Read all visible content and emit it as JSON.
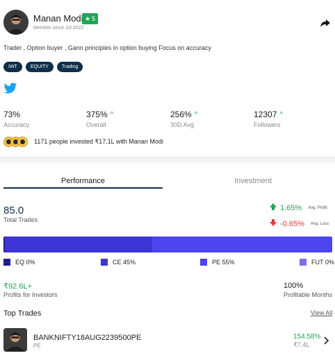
{
  "profile": {
    "name": "Manan Modi",
    "rating": "5",
    "member_since": "Member since Jul 2022",
    "bio": "Trader , Option buyer , Gann principles in option buying Focus on accuracy",
    "tags": [
      "IWT",
      "EQUITY",
      "Trading"
    ],
    "social": "twitter-icon"
  },
  "stats": [
    {
      "value": "73%",
      "label": "Accuracy",
      "trend": ""
    },
    {
      "value": "375%",
      "label": "Overall",
      "trend": "up"
    },
    {
      "value": "256%",
      "label": "30D Avg",
      "trend": "up"
    },
    {
      "value": "12307",
      "label": "Followers",
      "trend": "up"
    }
  ],
  "investors": {
    "text": "1171 people invested ₹17.1L with Manan Modi"
  },
  "tabs": {
    "performance": "Performance",
    "investment": "Investment",
    "active": "Performance"
  },
  "performance": {
    "total_trades_value": "85.0",
    "total_trades_label": "Total Trades",
    "avg_profit_value": "1.65%",
    "avg_profit_label": "Avg. Profit",
    "avg_loss_value": "-0.65%",
    "avg_loss_label": "Avg. Loss",
    "distribution": [
      {
        "label": "EQ 0%",
        "percent": 0,
        "color": "#1e1e8c"
      },
      {
        "label": "CE 45%",
        "percent": 45,
        "color": "#3d34d6"
      },
      {
        "label": "PE 55%",
        "percent": 55,
        "color": "#4c44ef"
      },
      {
        "label": "FUT 0%",
        "percent": 0,
        "color": "#7b6ef0"
      }
    ],
    "profits_value": "₹92.6L+",
    "profits_label": "Profits for Investors",
    "profitable_months_value": "100%",
    "profitable_months_label": "Profitable Months"
  },
  "top_trades": {
    "title": "Top Trades",
    "view_all": "View All",
    "items": [
      {
        "symbol": "BANKNIFTY18AUG2239500PE",
        "type": "PE",
        "return": "154.58%",
        "amount": "₹7.4L"
      }
    ]
  },
  "colors": {
    "navy": "#0f2e4a",
    "green": "#23a455",
    "red": "#e53935"
  }
}
